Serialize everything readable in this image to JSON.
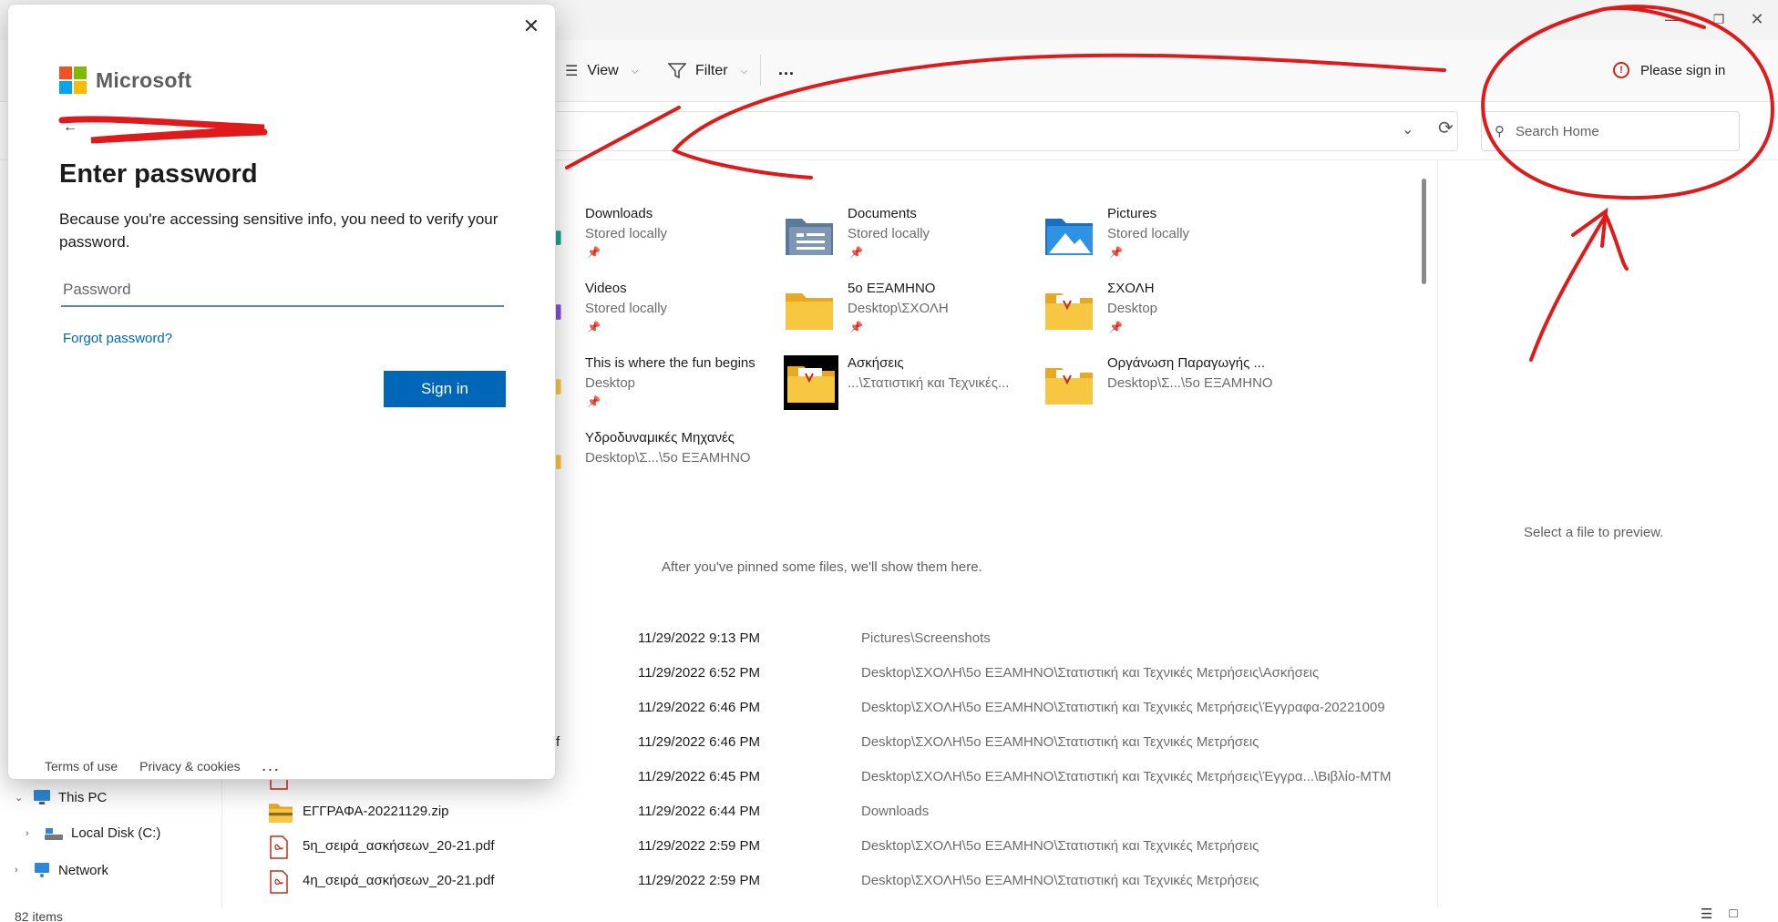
{
  "toolbar": {
    "view_label": "View",
    "filter_label": "Filter",
    "more_label": "...",
    "signin_warning": "Please sign in"
  },
  "search": {
    "placeholder": "Search Home"
  },
  "quick_access": [
    {
      "name": "Downloads",
      "sub": "Stored locally"
    },
    {
      "name": "Documents",
      "sub": "Stored locally"
    },
    {
      "name": "Pictures",
      "sub": "Stored locally"
    },
    {
      "name": "Videos",
      "sub": "Stored locally"
    },
    {
      "name": "5ο ΕΞΑΜΗΝΟ",
      "sub": "Desktop\\ΣΧΟΛΗ"
    },
    {
      "name": "ΣΧΟΛΗ",
      "sub": "Desktop"
    },
    {
      "name": "This is where the fun begins",
      "sub": "Desktop"
    },
    {
      "name": "Ασκήσεις",
      "sub": "...\\Στατιστική και Τεχνικές..."
    },
    {
      "name": "Οργάνωση Παραγωγής ...",
      "sub": "Desktop\\Σ...\\5ο ΕΞΑΜΗΝΟ"
    },
    {
      "name": "Υδροδυναμικές Μηχανές",
      "sub": "Desktop\\Σ...\\5ο ΕΞΑΜΗΝΟ"
    }
  ],
  "pinned_message": "After you've pinned some files, we'll show them here.",
  "preview_message": "Select a file to preview.",
  "recent": [
    {
      "name": "",
      "date": "11/29/2022 9:13 PM",
      "location": "Pictures\\Screenshots"
    },
    {
      "name": "",
      "date": "11/29/2022 6:52 PM",
      "location": "Desktop\\ΣΧΟΛΗ\\5ο ΕΞΑΜΗΝΟ\\Στατιστική και Τεχνικές Μετρήσεις\\Ασκήσεις"
    },
    {
      "name": "",
      "date": "11/29/2022 6:46 PM",
      "location": "Desktop\\ΣΧΟΛΗ\\5ο ΕΞΑΜΗΝΟ\\Στατιστική και Τεχνικές Μετρήσεις\\Έγγραφα-20221009"
    },
    {
      "name": "f",
      "date": "11/29/2022 6:46 PM",
      "location": "Desktop\\ΣΧΟΛΗ\\5ο ΕΞΑΜΗΝΟ\\Στατιστική και Τεχνικές Μετρήσεις"
    },
    {
      "name": "",
      "date": "11/29/2022 6:45 PM",
      "location": "Desktop\\ΣΧΟΛΗ\\5ο ΕΞΑΜΗΝΟ\\Στατιστική και Τεχνικές Μετρήσεις\\Έγγρα...\\Βιβλίο-ΜΤΜ"
    },
    {
      "name": "ΕΓΓΡΑΦΑ-20221129.zip",
      "date": "11/29/2022 6:44 PM",
      "location": "Downloads"
    },
    {
      "name": "5η_σειρά_ασκήσεων_20-21.pdf",
      "date": "11/29/2022 2:59 PM",
      "location": "Desktop\\ΣΧΟΛΗ\\5ο ΕΞΑΜΗΝΟ\\Στατιστική και Τεχνικές Μετρήσεις"
    },
    {
      "name": "4η_σειρά_ασκήσεων_20-21.pdf",
      "date": "11/29/2022 2:59 PM",
      "location": "Desktop\\ΣΧΟΛΗ\\5ο ΕΞΑΜΗΝΟ\\Στατιστική και Τεχνικές Μετρήσεις"
    }
  ],
  "nav": {
    "this_pc": "This PC",
    "local_disk": "Local Disk (C:)",
    "network": "Network"
  },
  "status": {
    "items": "82 items"
  },
  "dialog": {
    "brand": "Microsoft",
    "title": "Enter password",
    "description": "Because you're accessing sensitive info, you need to verify your password.",
    "password_placeholder": "Password",
    "forgot_link": "Forgot password?",
    "signin_button": "Sign in",
    "footer_terms": "Terms of use",
    "footer_privacy": "Privacy & cookies",
    "footer_more": "..."
  },
  "colors": {
    "ms_red": "#f25022",
    "ms_green": "#7fba00",
    "ms_blue": "#00a4ef",
    "ms_yellow": "#ffb900",
    "accent": "#0067b8",
    "warning": "#c42b1c",
    "annotation": "#e0191b",
    "folder": "#f8c742"
  }
}
